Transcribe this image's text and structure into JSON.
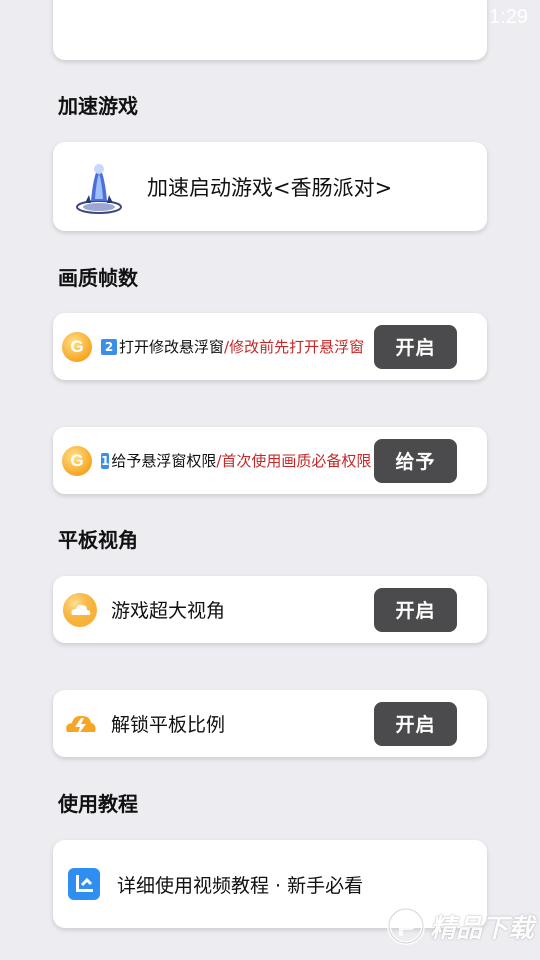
{
  "status": {
    "time": "1:29"
  },
  "sections": {
    "accelerate": "加速游戏",
    "quality": "画质帧数",
    "tablet": "平板视角",
    "tutorial": "使用教程"
  },
  "launch_card": {
    "label": "加速启动游戏<香肠派对>"
  },
  "quality_options": [
    {
      "badge": "2",
      "title": "打开修改悬浮窗",
      "hint": "/修改前先打开悬浮窗",
      "button": "开启"
    },
    {
      "badge": "1",
      "title": "给予悬浮窗权限",
      "hint": "/首次使用画质必备权限",
      "button": "给予"
    }
  ],
  "tablet_options": [
    {
      "label": "游戏超大视角",
      "button": "开启"
    },
    {
      "label": "解锁平板比例",
      "button": "开启"
    }
  ],
  "tutorial_card": {
    "label": "详细使用视频教程 · 新手必看"
  },
  "watermark": {
    "text": "精品下载"
  },
  "colors": {
    "accent_orange": "#f6a623",
    "button_bg": "#4b4b4d",
    "hint_red": "#c62828",
    "tutorial_blue": "#2f8ff0"
  }
}
